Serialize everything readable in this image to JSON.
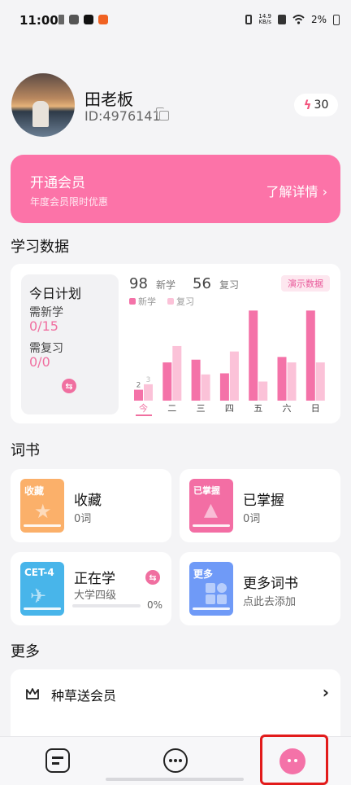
{
  "status_bar": {
    "time": "11:00",
    "speed_value": "14.9",
    "speed_unit": "KB/s",
    "battery": "2%"
  },
  "profile": {
    "name": "田老板",
    "id_text": "ID:4976141",
    "energy": "30"
  },
  "vip_banner": {
    "title": "开通会员",
    "subtitle": "年度会员限时优惠",
    "action": "了解详情"
  },
  "study": {
    "section_title": "学习数据",
    "plan": {
      "title": "今日计划",
      "new_label": "需新学",
      "new_value": "0/15",
      "review_label": "需复习",
      "review_value": "0/0"
    },
    "new_count": "98",
    "new_label": "新学",
    "review_count": "56",
    "review_label": "复习",
    "demo_badge": "演示数据",
    "legend": {
      "new": "新学",
      "review": "复习"
    }
  },
  "chart_data": {
    "type": "bar",
    "categories": [
      "今",
      "二",
      "三",
      "四",
      "五",
      "六",
      "日"
    ],
    "series": [
      {
        "name": "新学",
        "color": "#f472a8",
        "values": [
          2,
          7,
          7.5,
          5,
          16.5,
          8,
          16.5
        ]
      },
      {
        "name": "复习",
        "color": "#fbc2d8",
        "values": [
          3,
          10,
          4.8,
          9,
          3.5,
          7,
          7
        ]
      }
    ],
    "data_labels": {
      "new": "2",
      "review": "3"
    },
    "ylim": [
      0,
      17
    ]
  },
  "books": {
    "section_title": "词书",
    "items": [
      {
        "tag": "收藏",
        "title": "收藏",
        "sub": "0词",
        "color": "#fbb06a"
      },
      {
        "tag": "已掌握",
        "title": "已掌握",
        "sub": "0词",
        "color": "#f36ea4"
      },
      {
        "tag": "CET-4",
        "title": "正在学",
        "sub": "大学四级",
        "progress": "0%",
        "progress_value": 0,
        "color": "#48b5ea"
      },
      {
        "tag": "更多",
        "title": "更多词书",
        "sub": "点此去添加",
        "color": "#6f9af7"
      }
    ]
  },
  "more": {
    "section_title": "更多",
    "items": [
      {
        "label": "种草送会员"
      }
    ]
  }
}
